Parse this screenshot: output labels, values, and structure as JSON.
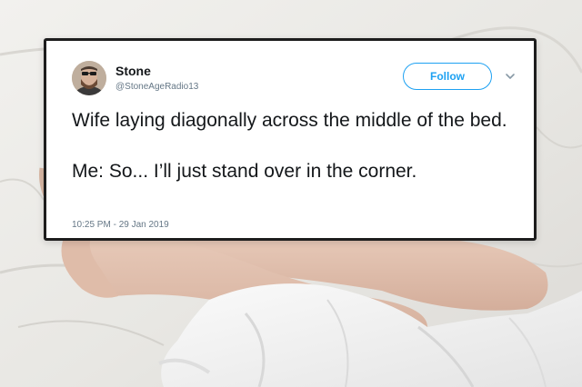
{
  "tweet": {
    "author_name": "Stone",
    "author_handle": "@StoneAgeRadio13",
    "follow_label": "Follow",
    "text_line1": "Wife laying diagonally across the middle of the bed.",
    "text_line2": "Me: So... I’ll just stand over in the corner.",
    "timestamp": "10:25 PM - 29 Jan 2019"
  },
  "colors": {
    "accent": "#1da1f2",
    "text_primary": "#14171a",
    "text_secondary": "#657786",
    "card_border": "#1d1d1d"
  },
  "icons": {
    "menu": "chevron-down-icon",
    "avatar": "avatar"
  }
}
